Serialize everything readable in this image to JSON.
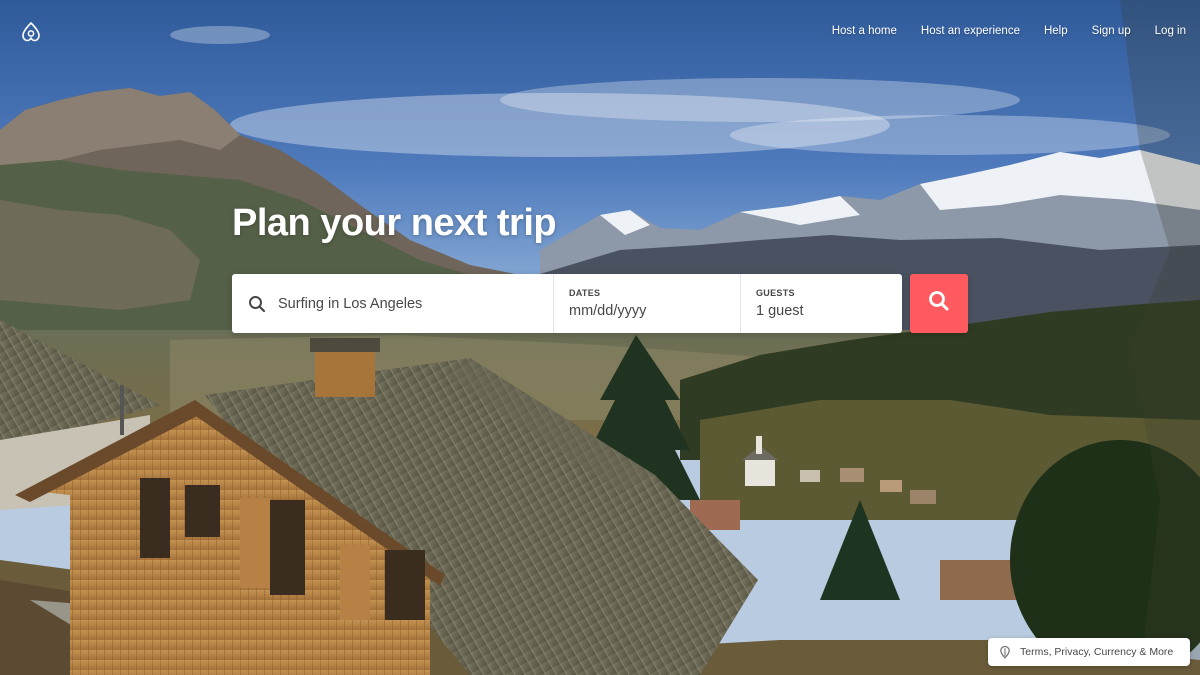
{
  "header": {
    "logo_icon": "airbnb-logo-icon",
    "nav": [
      {
        "label": "Host a home"
      },
      {
        "label": "Host an experience"
      },
      {
        "label": "Help"
      },
      {
        "label": "Sign up"
      },
      {
        "label": "Log in"
      }
    ]
  },
  "hero": {
    "title": "Plan your next trip"
  },
  "search": {
    "where_placeholder": "Surfing in Los Angeles",
    "search_icon": "search-icon",
    "dates_label": "DATES",
    "dates_value": "mm/dd/yyyy",
    "guests_label": "GUESTS",
    "guests_value": "1 guest",
    "button_icon": "search-icon",
    "button_color": "#ff5a5f"
  },
  "footer": {
    "icon": "globe-icon",
    "label": "Terms, Privacy, Currency & More"
  }
}
